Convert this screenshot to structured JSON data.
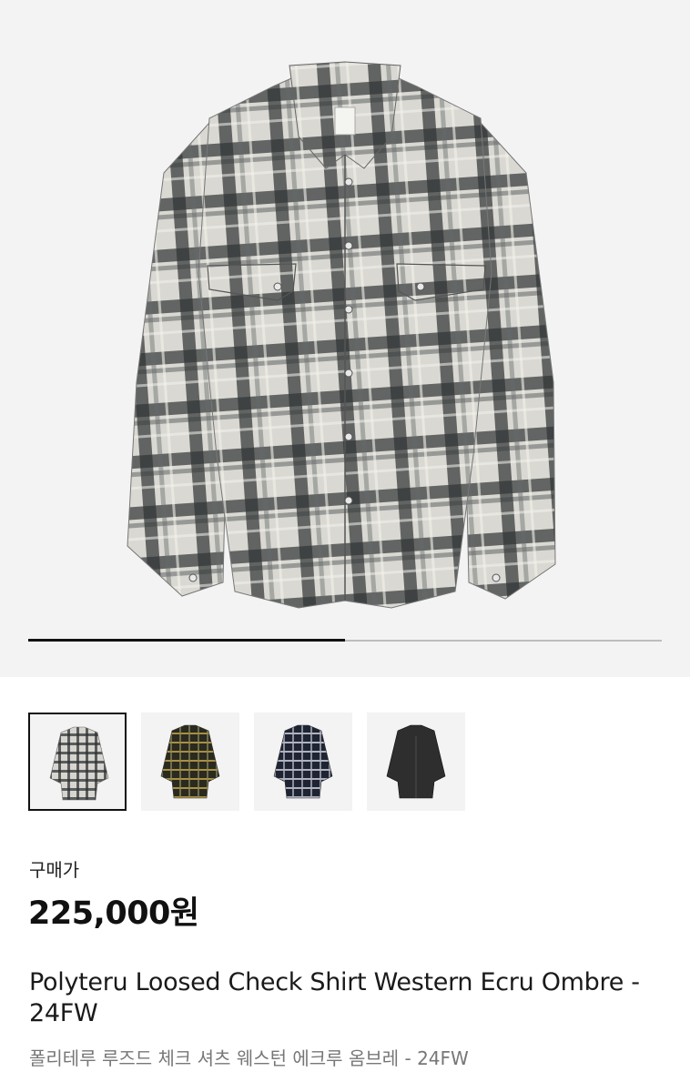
{
  "product": {
    "main_image": "plaid-western-shirt-ecru-ombre",
    "image_carousel_progress": 0.5,
    "thumbnails": [
      {
        "name": "ecru-ombre-plaid-shirt",
        "selected": true
      },
      {
        "name": "olive-plaid-shirt",
        "selected": false
      },
      {
        "name": "navy-plaid-shirt",
        "selected": false
      },
      {
        "name": "charcoal-solid-shirt",
        "selected": false
      }
    ],
    "price_label": "구매가",
    "price": "225,000원",
    "title_en": "Polyteru Loosed Check Shirt Western Ecru Ombre - 24FW",
    "title_ko": "폴리테루 루즈드 체크 셔츠 웨스턴 에크루 옴브레 - 24FW"
  },
  "colors": {
    "hero_bg": "#f3f3f3",
    "progress_fill": "#111111",
    "progress_track": "#bdbdbd",
    "subtitle": "#777777"
  }
}
